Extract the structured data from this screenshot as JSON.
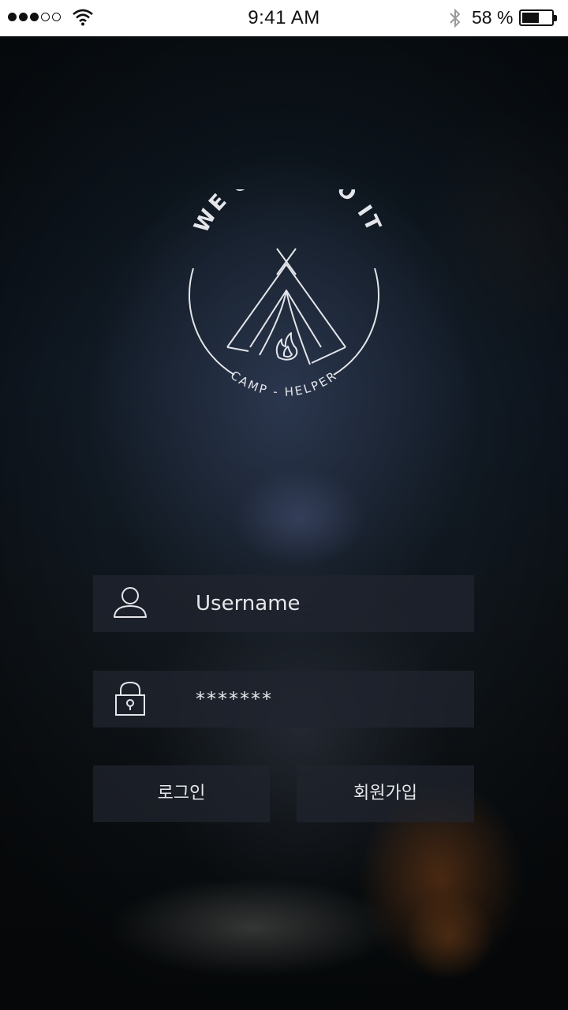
{
  "status_bar": {
    "time": "9:41 AM",
    "battery_percent_label": "58 %",
    "battery_level": 0.58,
    "signal_bars_filled": 3,
    "signal_bars_total": 5
  },
  "logo": {
    "top_text": "WE CAMP DO IT",
    "bottom_text": "CAMP - HELPER"
  },
  "form": {
    "username_label": "Username",
    "password_masked": "*******",
    "login_label": "로그인",
    "signup_label": "회원가입"
  },
  "colors": {
    "overlay_field": "#20242e",
    "text_light": "#e6e7ea"
  }
}
